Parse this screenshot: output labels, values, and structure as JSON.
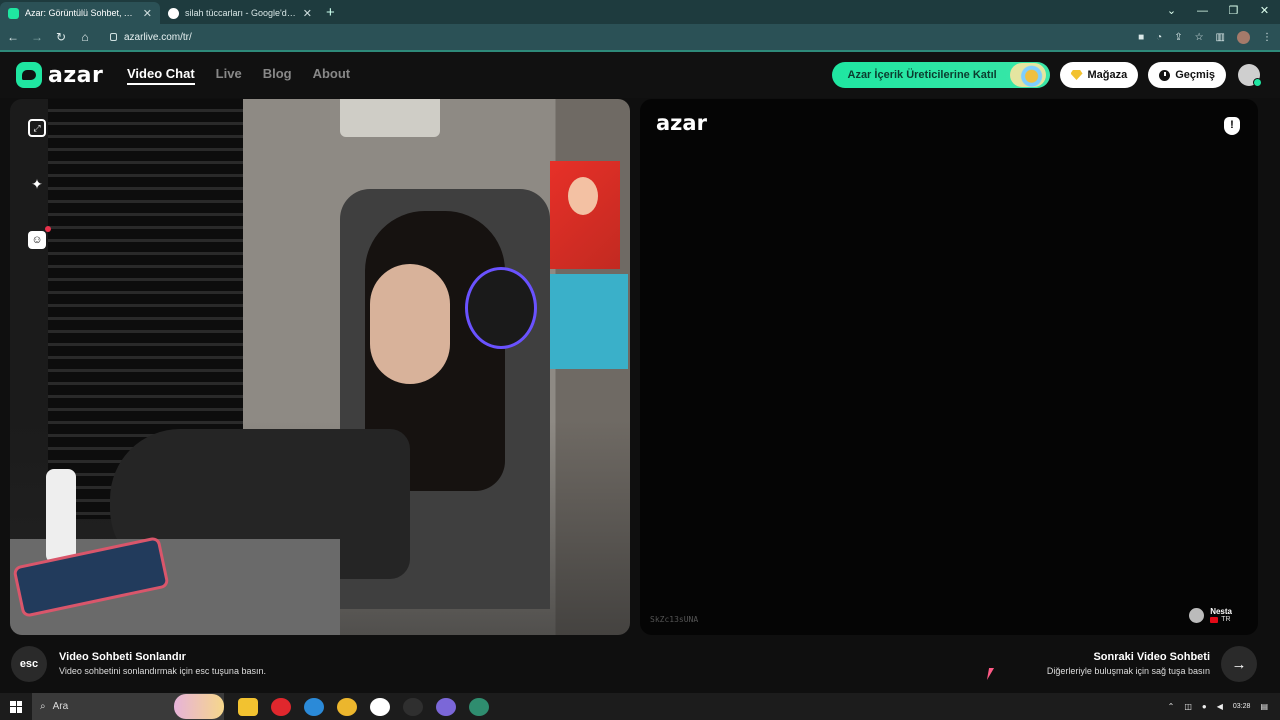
{
  "browser": {
    "tabs": [
      {
        "title": "Azar: Görüntülü Sohbet, Arkadaş Edinin",
        "favicon_color": "#1fe6a1",
        "active": true
      },
      {
        "title": "silah tüccarları - Google'da Ara",
        "favicon_color": "#ffffff",
        "active": false
      }
    ],
    "new_tab": "+",
    "url": "azarlive.com/tr/",
    "window_controls": [
      "⌄",
      "—",
      "❐",
      "✕"
    ]
  },
  "site": {
    "logo": "azar",
    "nav": [
      {
        "label": "Video Chat",
        "active": true
      },
      {
        "label": "Live",
        "active": false
      },
      {
        "label": "Blog",
        "active": false
      },
      {
        "label": "About",
        "active": false
      }
    ],
    "creator_button": "Azar İçerik Üreticilerine Katıl",
    "shop_button": "Mağaza",
    "history_button": "Geçmiş",
    "accent_color": "#1fe6a1"
  },
  "remote_panel": {
    "logo": "azar",
    "report_icon": "!",
    "session_id": "SkZc13sUNA",
    "peer_name": "Nesta",
    "peer_country": "TR"
  },
  "footer": {
    "esc_label": "esc",
    "end_title": "Video Sohbeti Sonlandır",
    "end_subtitle": "Video sohbetini sonlandırmak için esc tuşuna basın.",
    "next_title": "Sonraki Video Sohbeti",
    "next_subtitle": "Diğerleriyle buluşmak için sağ tuşa basın",
    "next_arrow": "→"
  },
  "taskbar": {
    "search_placeholder": "Ara",
    "time": "03:28",
    "pinned_colors": [
      "#f2c230",
      "#e0272d",
      "#2b8ad8",
      "#ecb62d",
      "#ffffff",
      "#2f2f2f",
      "#7b67d8",
      "#2f8d6f"
    ]
  }
}
